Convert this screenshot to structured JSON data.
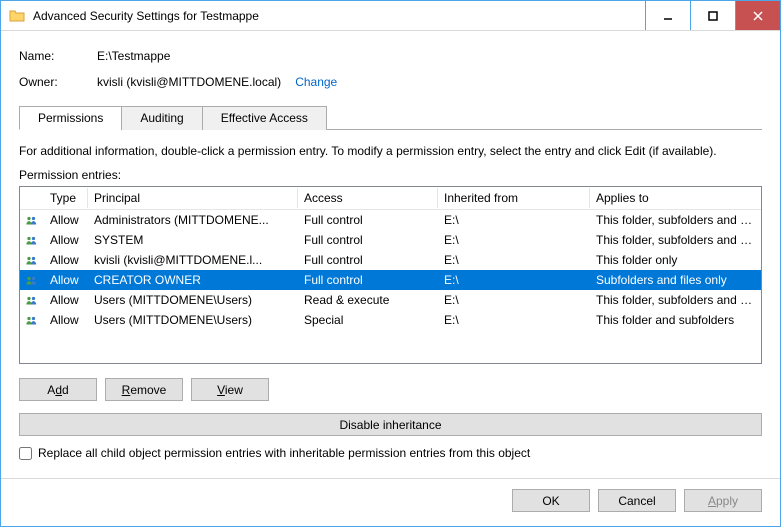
{
  "window": {
    "title": "Advanced Security Settings for Testmappe"
  },
  "fields": {
    "name_label": "Name:",
    "name_value": "E:\\Testmappe",
    "owner_label": "Owner:",
    "owner_value": "kvisli (kvisli@MITTDOMENE.local)",
    "change_link": "Change"
  },
  "tabs": {
    "permissions": "Permissions",
    "auditing": "Auditing",
    "effective": "Effective Access"
  },
  "info_text": "For additional information, double-click a permission entry. To modify a permission entry, select the entry and click Edit (if available).",
  "entries_label": "Permission entries:",
  "grid_headers": {
    "type": "Type",
    "principal": "Principal",
    "access": "Access",
    "inherited": "Inherited from",
    "applies": "Applies to"
  },
  "entries": [
    {
      "type": "Allow",
      "principal": "Administrators (MITTDOMENE...",
      "access": "Full control",
      "inherited": "E:\\",
      "applies": "This folder, subfolders and files",
      "selected": false
    },
    {
      "type": "Allow",
      "principal": "SYSTEM",
      "access": "Full control",
      "inherited": "E:\\",
      "applies": "This folder, subfolders and files",
      "selected": false
    },
    {
      "type": "Allow",
      "principal": "kvisli (kvisli@MITTDOMENE.l...",
      "access": "Full control",
      "inherited": "E:\\",
      "applies": "This folder only",
      "selected": false
    },
    {
      "type": "Allow",
      "principal": "CREATOR OWNER",
      "access": "Full control",
      "inherited": "E:\\",
      "applies": "Subfolders and files only",
      "selected": true
    },
    {
      "type": "Allow",
      "principal": "Users (MITTDOMENE\\Users)",
      "access": "Read & execute",
      "inherited": "E:\\",
      "applies": "This folder, subfolders and files",
      "selected": false
    },
    {
      "type": "Allow",
      "principal": "Users (MITTDOMENE\\Users)",
      "access": "Special",
      "inherited": "E:\\",
      "applies": "This folder and subfolders",
      "selected": false
    }
  ],
  "buttons": {
    "add": "Add",
    "remove": "Remove",
    "view": "View",
    "disable": "Disable inheritance",
    "ok": "OK",
    "cancel": "Cancel",
    "apply": "Apply"
  },
  "replace_label": "Replace all child object permission entries with inheritable permission entries from this object"
}
